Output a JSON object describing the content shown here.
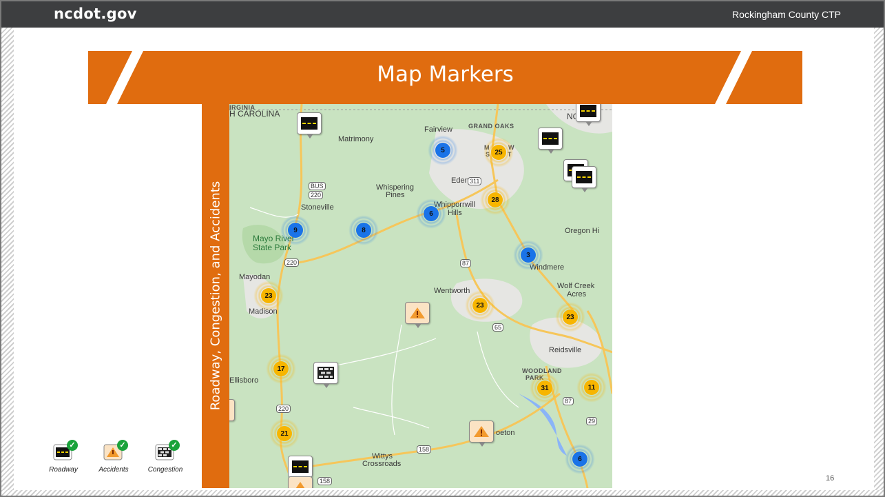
{
  "header": {
    "brand": "ncdot.gov",
    "county": "Rockingham County CTP"
  },
  "slide": {
    "title": "Map Markers",
    "side_label": "Roadway, Congestion, and Accidents",
    "page_number": "16"
  },
  "colors": {
    "accent": "#e06c0f",
    "topbar": "#3d3e40",
    "cluster_blue": "#1a73e8",
    "cluster_gold": "#f7b500"
  },
  "map": {
    "places": [
      "IRGINIA",
      "H CAROLINA",
      "Matrimony",
      "Fairview",
      "GRAND OAKS",
      "Eden",
      "Whispering",
      "Pines",
      "Whipporrwill",
      "Hills",
      "Stoneville",
      "Mayo River",
      "State Park",
      "Oregon Hi",
      "Windmere",
      "Mayodan",
      "Wentworth",
      "Wolf Creek",
      "Acres",
      "Madison",
      "Reidsville",
      "Ellisboro",
      "WOODLAND",
      "PARK",
      "oeton",
      "Wittys",
      "Crossroads",
      "NC",
      "M",
      "W",
      "S",
      "T"
    ],
    "shields": [
      "BUS",
      "220",
      "311",
      "87",
      "220",
      "65",
      "87",
      "29",
      "220",
      "158",
      "158"
    ],
    "clusters": [
      {
        "label": "5",
        "kind": "blue"
      },
      {
        "label": "25",
        "kind": "gold"
      },
      {
        "label": "28",
        "kind": "gold"
      },
      {
        "label": "6",
        "kind": "blue"
      },
      {
        "label": "9",
        "kind": "blue"
      },
      {
        "label": "8",
        "kind": "blue"
      },
      {
        "label": "3",
        "kind": "blue"
      },
      {
        "label": "23",
        "kind": "gold"
      },
      {
        "label": "23",
        "kind": "gold"
      },
      {
        "label": "23",
        "kind": "gold"
      },
      {
        "label": "17",
        "kind": "gold"
      },
      {
        "label": "31",
        "kind": "gold"
      },
      {
        "label": "11",
        "kind": "gold"
      },
      {
        "label": "21",
        "kind": "gold"
      },
      {
        "label": "6",
        "kind": "blue"
      }
    ]
  },
  "legend": [
    {
      "label": "Roadway",
      "icon": "roadway-icon"
    },
    {
      "label": "Accidents",
      "icon": "accident-icon"
    },
    {
      "label": "Congestion",
      "icon": "congestion-icon"
    }
  ]
}
